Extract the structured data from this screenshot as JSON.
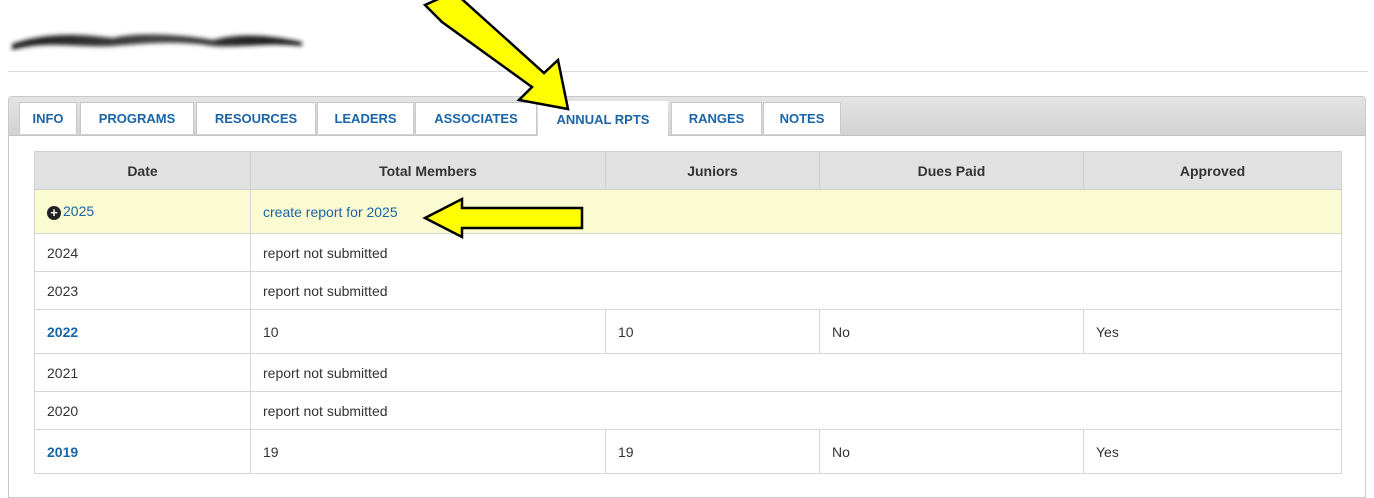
{
  "tabs": [
    {
      "label": "INFO"
    },
    {
      "label": "PROGRAMS"
    },
    {
      "label": "RESOURCES"
    },
    {
      "label": "LEADERS"
    },
    {
      "label": "ASSOCIATES"
    },
    {
      "label": "ANNUAL RPTS"
    },
    {
      "label": "RANGES"
    },
    {
      "label": "NOTES"
    }
  ],
  "active_tab": "ANNUAL RPTS",
  "table": {
    "headers": [
      "Date",
      "Total Members",
      "Juniors",
      "Dues Paid",
      "Approved"
    ],
    "new_row": {
      "year": "2025",
      "action": "create report for 2025"
    },
    "rows": [
      {
        "year": "2024",
        "status": "report not submitted"
      },
      {
        "year": "2023",
        "status": "report not submitted"
      },
      {
        "year": "2022",
        "total": "10",
        "juniors": "10",
        "dues": "No",
        "approved": "Yes"
      },
      {
        "year": "2021",
        "status": "report not submitted"
      },
      {
        "year": "2020",
        "status": "report not submitted"
      },
      {
        "year": "2019",
        "total": "19",
        "juniors": "19",
        "dues": "No",
        "approved": "Yes"
      }
    ]
  },
  "colors": {
    "link": "#1a64a8",
    "highlight_row": "#fbfbd1",
    "arrow_fill": "#ffff00"
  },
  "icons": {
    "add_report": "plus-circle-icon"
  }
}
